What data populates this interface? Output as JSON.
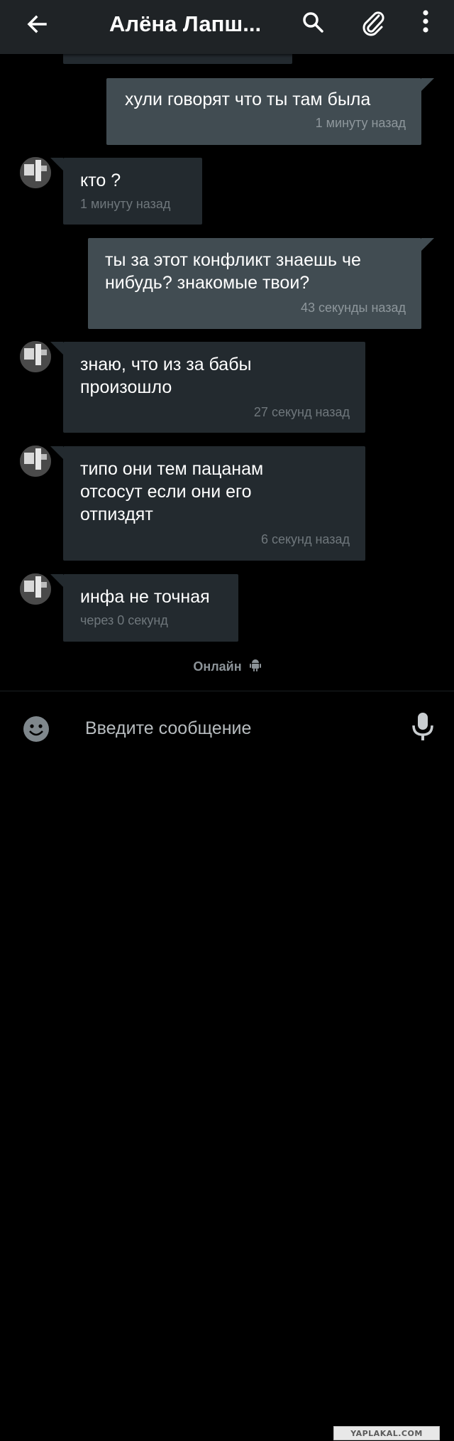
{
  "header": {
    "title": "Алёна Лапш...",
    "icons": [
      "back-arrow-icon",
      "search-icon",
      "attach-paperclip-icon",
      "more-vert-icon"
    ]
  },
  "messages": [
    {
      "direction": "out",
      "text": "хули говорят что ты там была",
      "time": "1 минуту назад"
    },
    {
      "direction": "in",
      "text": "кто ?",
      "time": "1 минуту назад"
    },
    {
      "direction": "out",
      "text": "ты за этот конфликт знаешь че\nнибудь? знакомые твои?",
      "time": "43 секунды назад"
    },
    {
      "direction": "in",
      "text": "знаю, что из за бабы\nпроизошло",
      "time": "27 секунд назад"
    },
    {
      "direction": "in",
      "text": "типо они тем пацанам\nотсосут если они его\nотпиздят",
      "time": "6 секунд назад"
    },
    {
      "direction": "in",
      "text": "инфа не точная",
      "time": "через 0 секунд"
    }
  ],
  "presence": {
    "label": "Онлайн",
    "icon": "android-icon"
  },
  "composer": {
    "placeholder": "Введите сообщение",
    "icons": [
      "emoji-icon",
      "microphone-icon"
    ]
  },
  "watermark": {
    "text": "YAPLAKAL.COM"
  },
  "colors": {
    "header_bg": "#1f2326",
    "outgoing_bubble": "#414c52",
    "incoming_bubble": "#232a2f",
    "background": "#000000"
  }
}
